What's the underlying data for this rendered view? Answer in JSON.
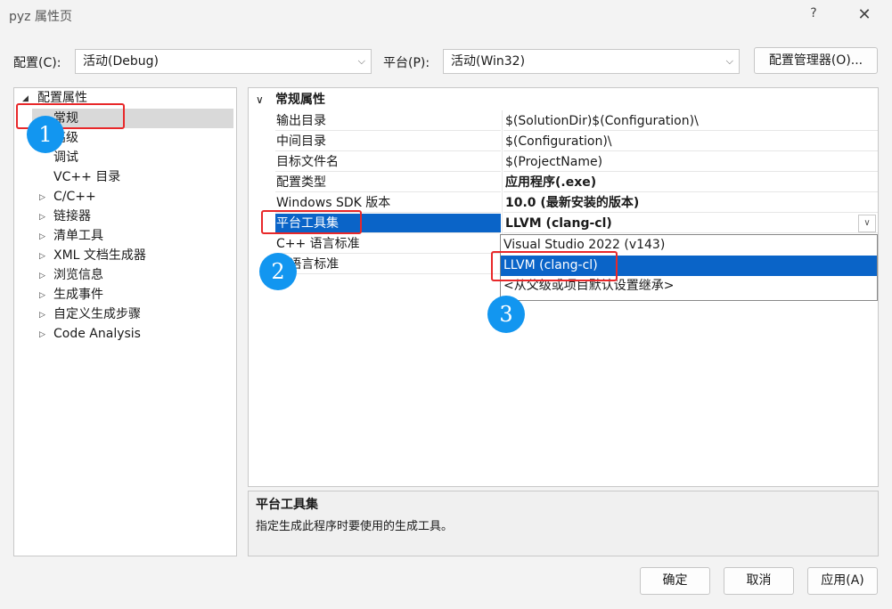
{
  "window": {
    "title": "pyz 属性页",
    "help": "?",
    "close": "✕"
  },
  "config": {
    "config_label": "配置(C):",
    "config_value": "活动(Debug)",
    "platform_label": "平台(P):",
    "platform_value": "活动(Win32)",
    "manager_button": "配置管理器(O)..."
  },
  "tree": {
    "root": "配置属性",
    "items": [
      "常规",
      "高级",
      "调试",
      "VC++ 目录",
      "C/C++",
      "链接器",
      "清单工具",
      "XML 文档生成器",
      "浏览信息",
      "生成事件",
      "自定义生成步骤",
      "Code Analysis"
    ]
  },
  "grid": {
    "section": "常规属性",
    "rows": [
      {
        "name": "输出目录",
        "value": "$(SolutionDir)$(Configuration)\\"
      },
      {
        "name": "中间目录",
        "value": "$(Configuration)\\"
      },
      {
        "name": "目标文件名",
        "value": "$(ProjectName)"
      },
      {
        "name": "配置类型",
        "value": "应用程序(.exe)"
      },
      {
        "name": "Windows SDK 版本",
        "value": "10.0 (最新安装的版本)"
      },
      {
        "name": "平台工具集",
        "value": "LLVM (clang-cl)"
      },
      {
        "name": "C++ 语言标准",
        "value": ""
      },
      {
        "name": "C 语言标准",
        "value": ""
      }
    ]
  },
  "dropdown": {
    "options": [
      "Visual Studio 2022 (v143)",
      "LLVM (clang-cl)",
      "<从父级或项目默认设置继承>"
    ],
    "selected": "LLVM (clang-cl)"
  },
  "description": {
    "title": "平台工具集",
    "text": "指定生成此程序时要使用的生成工具。"
  },
  "buttons": {
    "ok": "确定",
    "cancel": "取消",
    "apply": "应用(A)"
  },
  "annotations": {
    "one": "1",
    "two": "2",
    "three": "3",
    "box_color": "#e8282a",
    "badge_color": "#1296f0"
  },
  "colors": {
    "selection": "#0a64c8"
  }
}
